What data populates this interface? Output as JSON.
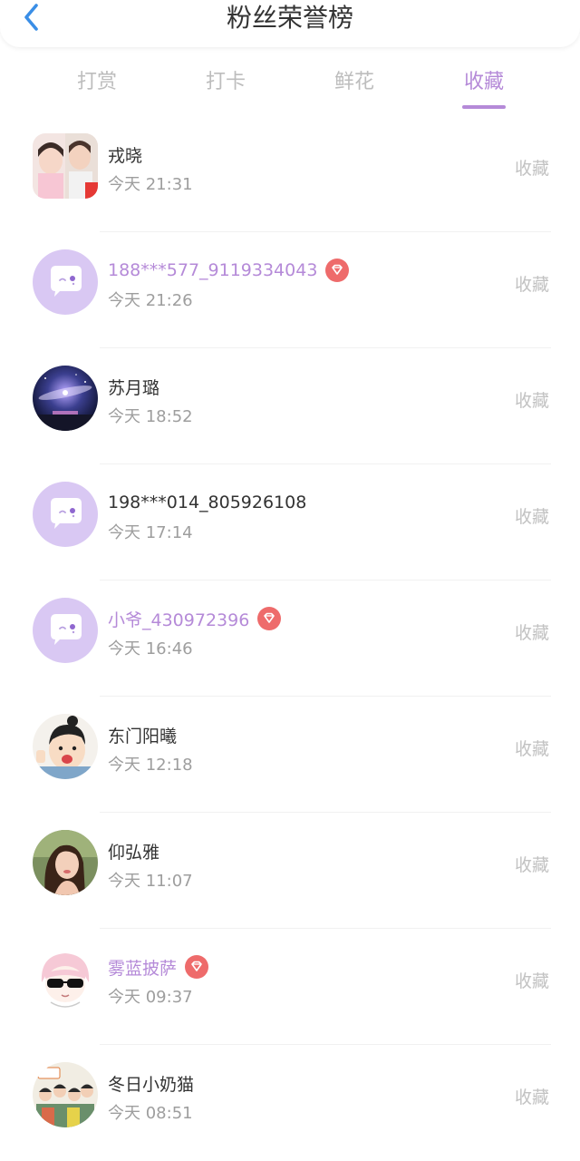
{
  "header": {
    "title": "粉丝荣誉榜",
    "back_icon": "chevron-left-icon"
  },
  "tabs": [
    {
      "label": "打赏",
      "active": false
    },
    {
      "label": "打卡",
      "active": false
    },
    {
      "label": "鲜花",
      "active": false
    },
    {
      "label": "收藏",
      "active": true
    }
  ],
  "colors": {
    "accent": "#b58ad8",
    "badge": "#ee6b6b",
    "default_avatar_bg": "#d9c8f3"
  },
  "fans": [
    {
      "name": "戎晓",
      "time": "今天 21:31",
      "action": "收藏",
      "vip": false,
      "avatar": "photo-avatar"
    },
    {
      "name": "188***577_9119334043",
      "time": "今天 21:26",
      "action": "收藏",
      "vip": true,
      "avatar": "default-chat-avatar"
    },
    {
      "name": "苏月璐",
      "time": "今天 18:52",
      "action": "收藏",
      "vip": false,
      "avatar": "galaxy-avatar"
    },
    {
      "name": "198***014_805926108",
      "time": "今天 17:14",
      "action": "收藏",
      "vip": false,
      "avatar": "default-chat-avatar"
    },
    {
      "name": "小爷_430972396",
      "time": "今天 16:46",
      "action": "收藏",
      "vip": true,
      "avatar": "default-chat-avatar"
    },
    {
      "name": "东门阳曦",
      "time": "今天 12:18",
      "action": "收藏",
      "vip": false,
      "avatar": "cartoon-avatar"
    },
    {
      "name": "仰弘雅",
      "time": "今天 11:07",
      "action": "收藏",
      "vip": false,
      "avatar": "portrait-avatar"
    },
    {
      "name": "雾蓝披萨",
      "time": "今天 09:37",
      "action": "收藏",
      "vip": true,
      "avatar": "anime-avatar"
    },
    {
      "name": "冬日小奶猫",
      "time": "今天 08:51",
      "action": "收藏",
      "vip": false,
      "avatar": "group-photo-avatar"
    }
  ]
}
